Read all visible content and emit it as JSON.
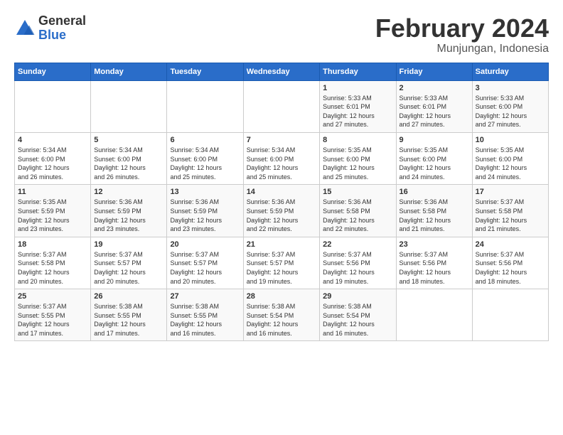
{
  "header": {
    "logo_general": "General",
    "logo_blue": "Blue",
    "month_title": "February 2024",
    "location": "Munjungan, Indonesia"
  },
  "weekdays": [
    "Sunday",
    "Monday",
    "Tuesday",
    "Wednesday",
    "Thursday",
    "Friday",
    "Saturday"
  ],
  "weeks": [
    [
      {
        "day": "",
        "info": ""
      },
      {
        "day": "",
        "info": ""
      },
      {
        "day": "",
        "info": ""
      },
      {
        "day": "",
        "info": ""
      },
      {
        "day": "1",
        "info": "Sunrise: 5:33 AM\nSunset: 6:01 PM\nDaylight: 12 hours\nand 27 minutes."
      },
      {
        "day": "2",
        "info": "Sunrise: 5:33 AM\nSunset: 6:01 PM\nDaylight: 12 hours\nand 27 minutes."
      },
      {
        "day": "3",
        "info": "Sunrise: 5:33 AM\nSunset: 6:00 PM\nDaylight: 12 hours\nand 27 minutes."
      }
    ],
    [
      {
        "day": "4",
        "info": "Sunrise: 5:34 AM\nSunset: 6:00 PM\nDaylight: 12 hours\nand 26 minutes."
      },
      {
        "day": "5",
        "info": "Sunrise: 5:34 AM\nSunset: 6:00 PM\nDaylight: 12 hours\nand 26 minutes."
      },
      {
        "day": "6",
        "info": "Sunrise: 5:34 AM\nSunset: 6:00 PM\nDaylight: 12 hours\nand 25 minutes."
      },
      {
        "day": "7",
        "info": "Sunrise: 5:34 AM\nSunset: 6:00 PM\nDaylight: 12 hours\nand 25 minutes."
      },
      {
        "day": "8",
        "info": "Sunrise: 5:35 AM\nSunset: 6:00 PM\nDaylight: 12 hours\nand 25 minutes."
      },
      {
        "day": "9",
        "info": "Sunrise: 5:35 AM\nSunset: 6:00 PM\nDaylight: 12 hours\nand 24 minutes."
      },
      {
        "day": "10",
        "info": "Sunrise: 5:35 AM\nSunset: 6:00 PM\nDaylight: 12 hours\nand 24 minutes."
      }
    ],
    [
      {
        "day": "11",
        "info": "Sunrise: 5:35 AM\nSunset: 5:59 PM\nDaylight: 12 hours\nand 23 minutes."
      },
      {
        "day": "12",
        "info": "Sunrise: 5:36 AM\nSunset: 5:59 PM\nDaylight: 12 hours\nand 23 minutes."
      },
      {
        "day": "13",
        "info": "Sunrise: 5:36 AM\nSunset: 5:59 PM\nDaylight: 12 hours\nand 23 minutes."
      },
      {
        "day": "14",
        "info": "Sunrise: 5:36 AM\nSunset: 5:59 PM\nDaylight: 12 hours\nand 22 minutes."
      },
      {
        "day": "15",
        "info": "Sunrise: 5:36 AM\nSunset: 5:58 PM\nDaylight: 12 hours\nand 22 minutes."
      },
      {
        "day": "16",
        "info": "Sunrise: 5:36 AM\nSunset: 5:58 PM\nDaylight: 12 hours\nand 21 minutes."
      },
      {
        "day": "17",
        "info": "Sunrise: 5:37 AM\nSunset: 5:58 PM\nDaylight: 12 hours\nand 21 minutes."
      }
    ],
    [
      {
        "day": "18",
        "info": "Sunrise: 5:37 AM\nSunset: 5:58 PM\nDaylight: 12 hours\nand 20 minutes."
      },
      {
        "day": "19",
        "info": "Sunrise: 5:37 AM\nSunset: 5:57 PM\nDaylight: 12 hours\nand 20 minutes."
      },
      {
        "day": "20",
        "info": "Sunrise: 5:37 AM\nSunset: 5:57 PM\nDaylight: 12 hours\nand 20 minutes."
      },
      {
        "day": "21",
        "info": "Sunrise: 5:37 AM\nSunset: 5:57 PM\nDaylight: 12 hours\nand 19 minutes."
      },
      {
        "day": "22",
        "info": "Sunrise: 5:37 AM\nSunset: 5:56 PM\nDaylight: 12 hours\nand 19 minutes."
      },
      {
        "day": "23",
        "info": "Sunrise: 5:37 AM\nSunset: 5:56 PM\nDaylight: 12 hours\nand 18 minutes."
      },
      {
        "day": "24",
        "info": "Sunrise: 5:37 AM\nSunset: 5:56 PM\nDaylight: 12 hours\nand 18 minutes."
      }
    ],
    [
      {
        "day": "25",
        "info": "Sunrise: 5:37 AM\nSunset: 5:55 PM\nDaylight: 12 hours\nand 17 minutes."
      },
      {
        "day": "26",
        "info": "Sunrise: 5:38 AM\nSunset: 5:55 PM\nDaylight: 12 hours\nand 17 minutes."
      },
      {
        "day": "27",
        "info": "Sunrise: 5:38 AM\nSunset: 5:55 PM\nDaylight: 12 hours\nand 16 minutes."
      },
      {
        "day": "28",
        "info": "Sunrise: 5:38 AM\nSunset: 5:54 PM\nDaylight: 12 hours\nand 16 minutes."
      },
      {
        "day": "29",
        "info": "Sunrise: 5:38 AM\nSunset: 5:54 PM\nDaylight: 12 hours\nand 16 minutes."
      },
      {
        "day": "",
        "info": ""
      },
      {
        "day": "",
        "info": ""
      }
    ]
  ]
}
